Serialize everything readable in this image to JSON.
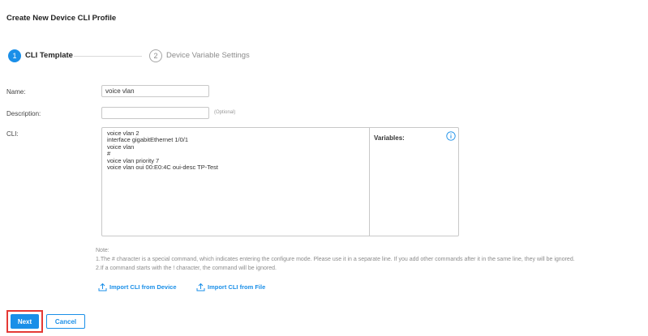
{
  "page": {
    "title": "Create New Device CLI Profile"
  },
  "steps": [
    {
      "number": "1",
      "label": "CLI Template",
      "active": true
    },
    {
      "number": "2",
      "label": "Device Variable Settings",
      "active": false
    }
  ],
  "form": {
    "name_label": "Name:",
    "name_value": "voice vlan",
    "description_label": "Description:",
    "description_value": "",
    "optional_text": "(Optional)",
    "cli_label": "CLI:",
    "cli_lines": [
      "voice vlan 2",
      "interface gigabitEthernet 1/0/1",
      "voice vlan",
      "#",
      "voice vlan priority 7",
      "voice vlan oui 00:E0:4C oui-desc TP-Test"
    ],
    "variables_label": "Variables:"
  },
  "notes": {
    "heading": "Note:",
    "line1": "1.The # character is a special command, which indicates entering the configure mode. Please use it in a separate line. If you add other commands after it in the same line, they will be ignored.",
    "line2": "2.If a command starts with the ! character, the command will be ignored."
  },
  "imports": {
    "from_device": "Import CLI from Device",
    "from_file": "Import CLI from File"
  },
  "buttons": {
    "next": "Next",
    "cancel": "Cancel"
  },
  "colors": {
    "accent": "#1a8fe8",
    "highlight": "#e53935"
  },
  "icons": {
    "info": "info-icon",
    "import": "upload-icon"
  }
}
